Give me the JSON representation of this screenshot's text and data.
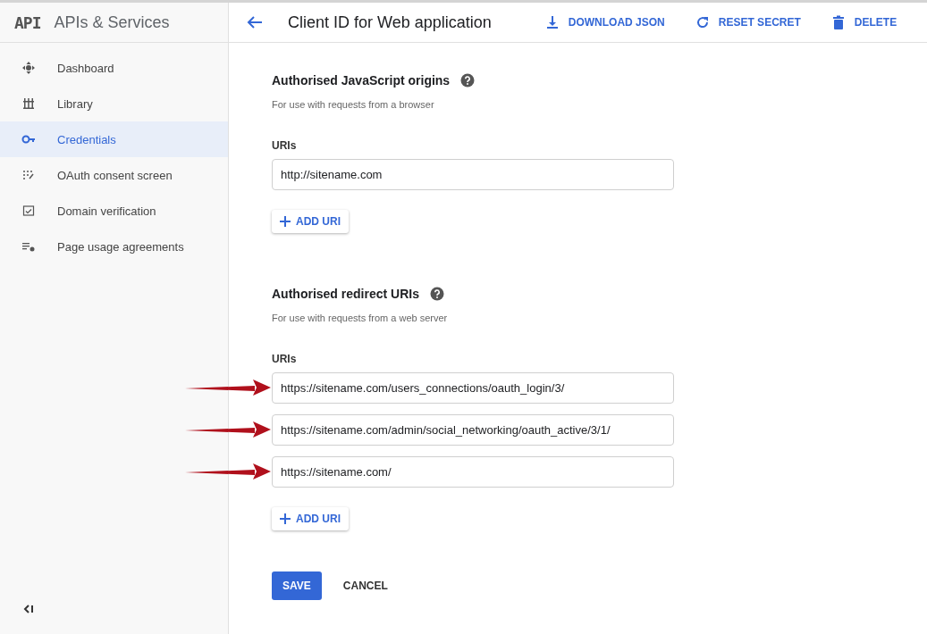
{
  "sidebar": {
    "logo": "API",
    "title": "APIs & Services",
    "items": [
      {
        "label": "Dashboard",
        "kind": "dashboard",
        "selected": false
      },
      {
        "label": "Library",
        "kind": "library",
        "selected": false
      },
      {
        "label": "Credentials",
        "kind": "key",
        "selected": true
      },
      {
        "label": "OAuth consent screen",
        "kind": "consent",
        "selected": false
      },
      {
        "label": "Domain verification",
        "kind": "verify",
        "selected": false
      },
      {
        "label": "Page usage agreements",
        "kind": "agreements",
        "selected": false
      }
    ]
  },
  "header": {
    "title": "Client ID for Web application",
    "actions": [
      {
        "label": "DOWNLOAD JSON",
        "kind": "download"
      },
      {
        "label": "RESET SECRET",
        "kind": "refresh"
      },
      {
        "label": "DELETE",
        "kind": "trash"
      }
    ]
  },
  "sections": [
    {
      "title": "Authorised JavaScript origins",
      "subtitle": "For use with requests from a browser",
      "field_label": "URIs",
      "uris": [
        {
          "value": "http://sitename.com",
          "arrow": false
        }
      ],
      "add_button": "ADD URI"
    },
    {
      "title": "Authorised redirect URIs",
      "subtitle": "For use with requests from a web server",
      "field_label": "URIs",
      "uris": [
        {
          "value": "https://sitename.com/users_connections/oauth_login/3/",
          "arrow": true
        },
        {
          "value": "https://sitename.com/admin/social_networking/oauth_active/3/1/",
          "arrow": true
        },
        {
          "value": "https://sitename.com/",
          "arrow": true
        }
      ],
      "add_button": "ADD URI"
    }
  ],
  "footer": {
    "save": "SAVE",
    "cancel": "CANCEL"
  }
}
